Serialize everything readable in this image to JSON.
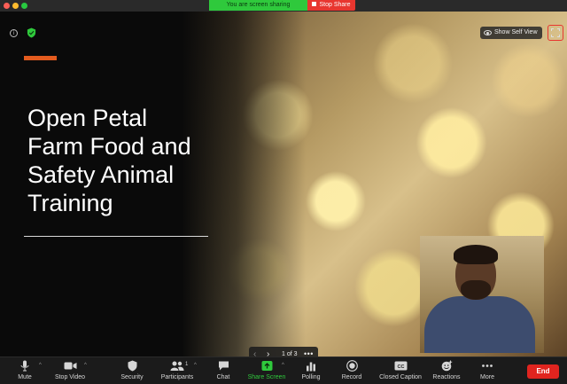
{
  "banner": {
    "sharing_text": "You are screen sharing",
    "stop_share_label": "Stop Share"
  },
  "top_controls": {
    "info_icon": "info-icon",
    "security_icon": "shield-check-icon",
    "show_self_view_label": "Show Self View",
    "fullscreen_icon": "fullscreen-icon"
  },
  "slide": {
    "title": "Open Petal Farm Food and Safety Animal Training",
    "accent_color": "#e35b1e"
  },
  "pager": {
    "prev_icon": "‹",
    "next_icon": "›",
    "label": "1 of 3",
    "more_icon": "•••"
  },
  "toolbar": {
    "mute": "Mute",
    "stop_video": "Stop Video",
    "security": "Security",
    "participants": "Participants",
    "participants_count": "1",
    "chat": "Chat",
    "share_screen": "Share Screen",
    "polling": "Polling",
    "record": "Record",
    "closed_caption": "Closed Caption",
    "reactions": "Reactions",
    "more": "More",
    "end": "End"
  },
  "colors": {
    "share_green": "#2fc93c",
    "stop_red": "#e8362f",
    "end_red": "#e0241f"
  }
}
